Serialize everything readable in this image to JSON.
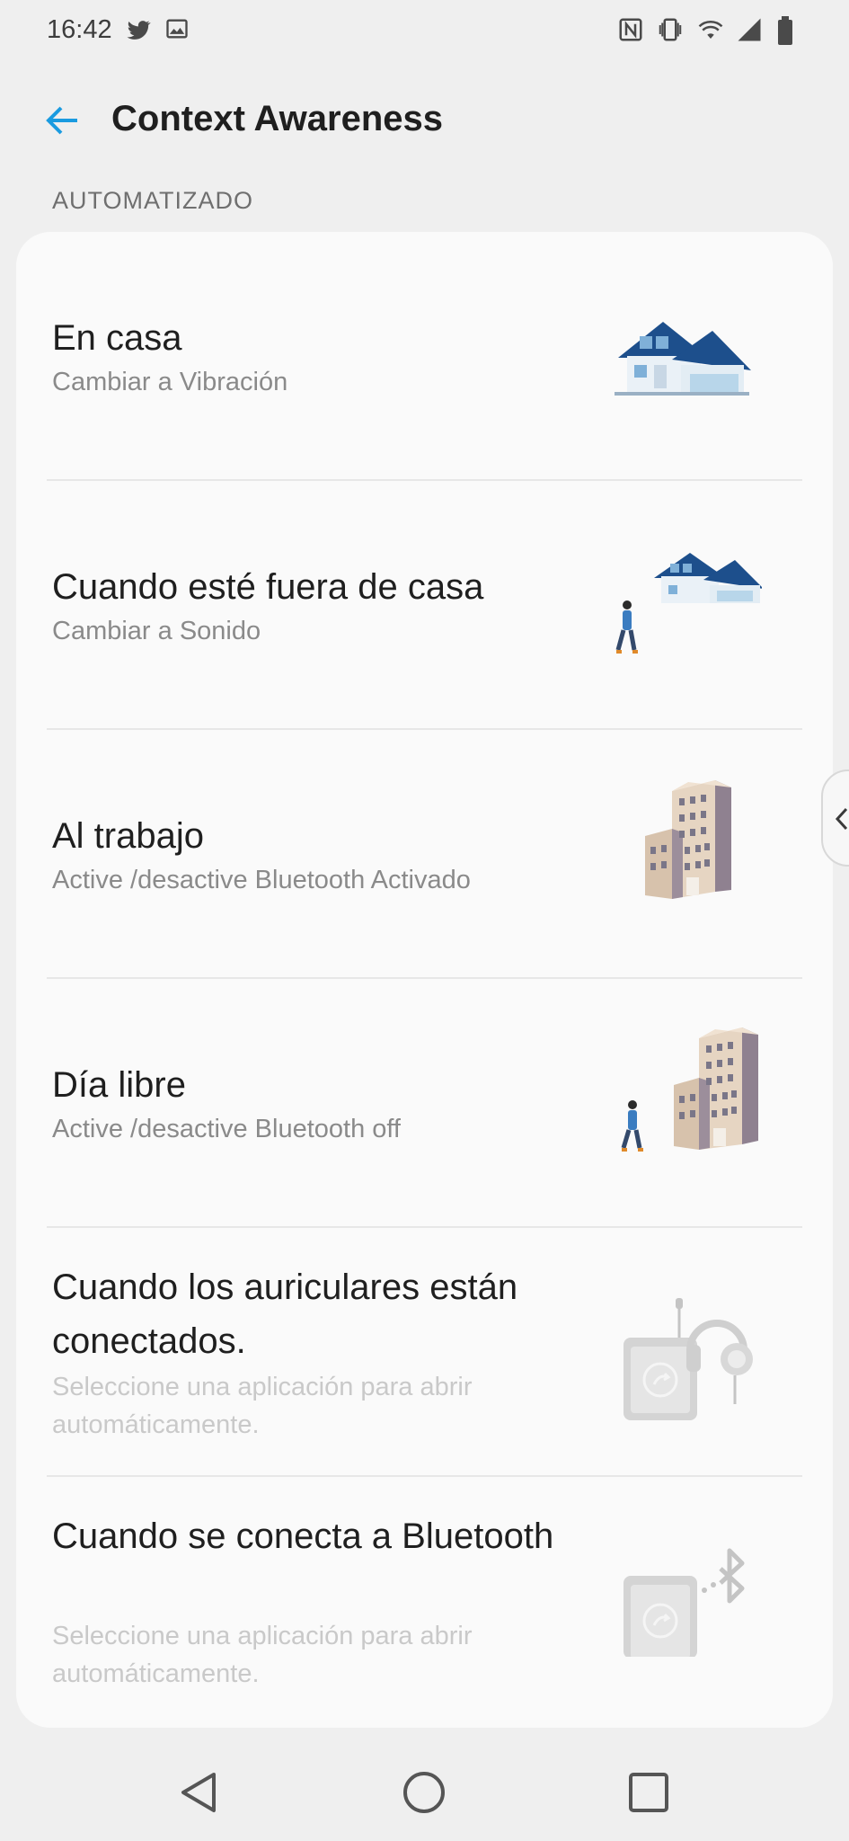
{
  "status_bar": {
    "time": "16:42",
    "left_icons": [
      "twitter-icon",
      "image-icon"
    ],
    "right_icons": [
      "nfc-icon",
      "vibrate-icon",
      "wifi-icon",
      "signal-icon",
      "battery-icon"
    ]
  },
  "app_bar": {
    "title": "Context Awareness",
    "back_icon": "arrow-left-icon",
    "accent_color": "#1a9be0"
  },
  "section": {
    "header": "AUTOMATIZADO"
  },
  "items": [
    {
      "title": "En casa",
      "subtitle": "Cambiar a Vibración",
      "enabled": true,
      "art": "house-art"
    },
    {
      "title": "Cuando esté fuera de casa",
      "subtitle": "Cambiar a Sonido",
      "enabled": true,
      "art": "house-walker-art"
    },
    {
      "title": "Al trabajo",
      "subtitle": "Active /desactive Bluetooth Activado",
      "enabled": true,
      "art": "office-building-art"
    },
    {
      "title": "Día libre",
      "subtitle": "Active /desactive Bluetooth off",
      "enabled": true,
      "art": "office-walker-art"
    },
    {
      "title": "Cuando los auriculares están conectados.",
      "subtitle": "Seleccione una aplicación para abrir automáticamente.",
      "enabled": false,
      "art": "headphones-phone-art"
    },
    {
      "title": "Cuando se conecta a Bluetooth",
      "subtitle": "Seleccione una aplicación para abrir automáticamente.",
      "enabled": false,
      "art": "bluetooth-phone-art"
    }
  ],
  "nav_bar": {
    "buttons": [
      "back-triangle-icon",
      "home-circle-icon",
      "recents-square-icon"
    ]
  }
}
